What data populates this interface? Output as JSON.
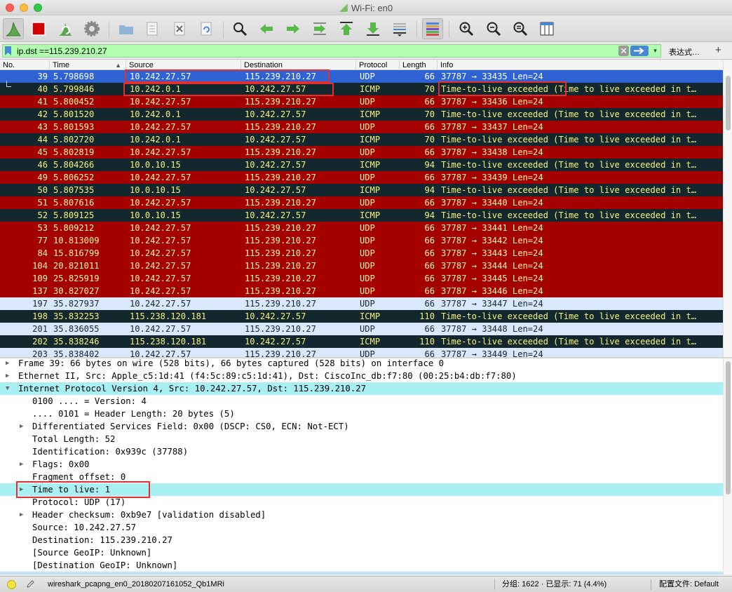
{
  "window": {
    "title": "Wi-Fi: en0"
  },
  "toolbar": {
    "buttons": [
      "shark-fin-start-icon",
      "stop-capture-icon",
      "restart-capture-icon",
      "capture-options-icon",
      "open-file-icon",
      "save-file-icon",
      "close-file-icon",
      "reload-file-icon",
      "find-packet-icon",
      "go-back-icon",
      "go-forward-icon",
      "go-to-packet-icon",
      "go-first-icon",
      "go-last-icon",
      "auto-scroll-icon",
      "colorize-icon",
      "zoom-in-icon",
      "zoom-out-icon",
      "zoom-normal-icon",
      "resize-columns-icon"
    ]
  },
  "filter": {
    "value": "ip.dst ==115.239.210.27",
    "clear_glyph": "✕",
    "dropdown_glyph": "▾",
    "expression_label": "表达式…",
    "add_glyph": "+"
  },
  "columns": [
    "No.",
    "Time",
    "Source",
    "Destination",
    "Protocol",
    "Length",
    "Info"
  ],
  "sort_indicator": "▲",
  "packets": [
    {
      "no": "39",
      "time": "5.798698",
      "src": "10.242.27.57",
      "dst": "115.239.210.27",
      "proto": "UDP",
      "len": "66",
      "info": "37787 → 33435  Len=24",
      "style": "sel"
    },
    {
      "no": "40",
      "time": "5.799846",
      "src": "10.242.0.1",
      "dst": "10.242.27.57",
      "proto": "ICMP",
      "len": "70",
      "info": "Time-to-live exceeded (Time to live exceeded in t…",
      "style": "dark"
    },
    {
      "no": "41",
      "time": "5.800452",
      "src": "10.242.27.57",
      "dst": "115.239.210.27",
      "proto": "UDP",
      "len": "66",
      "info": "37787 → 33436  Len=24",
      "style": "red"
    },
    {
      "no": "42",
      "time": "5.801520",
      "src": "10.242.0.1",
      "dst": "10.242.27.57",
      "proto": "ICMP",
      "len": "70",
      "info": "Time-to-live exceeded (Time to live exceeded in t…",
      "style": "dark"
    },
    {
      "no": "43",
      "time": "5.801593",
      "src": "10.242.27.57",
      "dst": "115.239.210.27",
      "proto": "UDP",
      "len": "66",
      "info": "37787 → 33437  Len=24",
      "style": "red"
    },
    {
      "no": "44",
      "time": "5.802720",
      "src": "10.242.0.1",
      "dst": "10.242.27.57",
      "proto": "ICMP",
      "len": "70",
      "info": "Time-to-live exceeded (Time to live exceeded in t…",
      "style": "dark"
    },
    {
      "no": "45",
      "time": "5.802819",
      "src": "10.242.27.57",
      "dst": "115.239.210.27",
      "proto": "UDP",
      "len": "66",
      "info": "37787 → 33438  Len=24",
      "style": "red"
    },
    {
      "no": "46",
      "time": "5.804266",
      "src": "10.0.10.15",
      "dst": "10.242.27.57",
      "proto": "ICMP",
      "len": "94",
      "info": "Time-to-live exceeded (Time to live exceeded in t…",
      "style": "dark"
    },
    {
      "no": "49",
      "time": "5.806252",
      "src": "10.242.27.57",
      "dst": "115.239.210.27",
      "proto": "UDP",
      "len": "66",
      "info": "37787 → 33439  Len=24",
      "style": "red"
    },
    {
      "no": "50",
      "time": "5.807535",
      "src": "10.0.10.15",
      "dst": "10.242.27.57",
      "proto": "ICMP",
      "len": "94",
      "info": "Time-to-live exceeded (Time to live exceeded in t…",
      "style": "dark"
    },
    {
      "no": "51",
      "time": "5.807616",
      "src": "10.242.27.57",
      "dst": "115.239.210.27",
      "proto": "UDP",
      "len": "66",
      "info": "37787 → 33440  Len=24",
      "style": "red"
    },
    {
      "no": "52",
      "time": "5.809125",
      "src": "10.0.10.15",
      "dst": "10.242.27.57",
      "proto": "ICMP",
      "len": "94",
      "info": "Time-to-live exceeded (Time to live exceeded in t…",
      "style": "dark"
    },
    {
      "no": "53",
      "time": "5.809212",
      "src": "10.242.27.57",
      "dst": "115.239.210.27",
      "proto": "UDP",
      "len": "66",
      "info": "37787 → 33441  Len=24",
      "style": "red"
    },
    {
      "no": "77",
      "time": "10.813009",
      "src": "10.242.27.57",
      "dst": "115.239.210.27",
      "proto": "UDP",
      "len": "66",
      "info": "37787 → 33442  Len=24",
      "style": "red"
    },
    {
      "no": "84",
      "time": "15.816799",
      "src": "10.242.27.57",
      "dst": "115.239.210.27",
      "proto": "UDP",
      "len": "66",
      "info": "37787 → 33443  Len=24",
      "style": "red"
    },
    {
      "no": "104",
      "time": "20.821011",
      "src": "10.242.27.57",
      "dst": "115.239.210.27",
      "proto": "UDP",
      "len": "66",
      "info": "37787 → 33444  Len=24",
      "style": "red"
    },
    {
      "no": "109",
      "time": "25.825919",
      "src": "10.242.27.57",
      "dst": "115.239.210.27",
      "proto": "UDP",
      "len": "66",
      "info": "37787 → 33445  Len=24",
      "style": "red"
    },
    {
      "no": "137",
      "time": "30.827027",
      "src": "10.242.27.57",
      "dst": "115.239.210.27",
      "proto": "UDP",
      "len": "66",
      "info": "37787 → 33446  Len=24",
      "style": "red"
    },
    {
      "no": "197",
      "time": "35.827937",
      "src": "10.242.27.57",
      "dst": "115.239.210.27",
      "proto": "UDP",
      "len": "66",
      "info": "37787 → 33447  Len=24",
      "style": "light"
    },
    {
      "no": "198",
      "time": "35.832253",
      "src": "115.238.120.181",
      "dst": "10.242.27.57",
      "proto": "ICMP",
      "len": "110",
      "info": "Time-to-live exceeded (Time to live exceeded in t…",
      "style": "dark"
    },
    {
      "no": "201",
      "time": "35.836055",
      "src": "10.242.27.57",
      "dst": "115.239.210.27",
      "proto": "UDP",
      "len": "66",
      "info": "37787 → 33448  Len=24",
      "style": "light"
    },
    {
      "no": "202",
      "time": "35.838246",
      "src": "115.238.120.181",
      "dst": "10.242.27.57",
      "proto": "ICMP",
      "len": "110",
      "info": "Time-to-live exceeded (Time to live exceeded in t…",
      "style": "dark"
    },
    {
      "no": "203",
      "time": "35.838402",
      "src": "10.242.27.57",
      "dst": "115.239.210.27",
      "proto": "UDP",
      "len": "66",
      "info": "37787 → 33449  Len=24",
      "style": "light"
    }
  ],
  "details": [
    {
      "text": "Frame 39: 66 bytes on wire (528 bits), 66 bytes captured (528 bits) on interface 0",
      "arrow": "▶",
      "indent": 0
    },
    {
      "text": "Ethernet II, Src: Apple_c5:1d:41 (f4:5c:89:c5:1d:41), Dst: CiscoInc_db:f7:80 (00:25:b4:db:f7:80)",
      "arrow": "▶",
      "indent": 0
    },
    {
      "text": "Internet Protocol Version 4, Src: 10.242.27.57, Dst: 115.239.210.27",
      "arrow": "▼",
      "indent": 0,
      "hl": true
    },
    {
      "text": "0100 .... = Version: 4",
      "arrow": "",
      "indent": 1
    },
    {
      "text": ".... 0101 = Header Length: 20 bytes (5)",
      "arrow": "",
      "indent": 1
    },
    {
      "text": "Differentiated Services Field: 0x00 (DSCP: CS0, ECN: Not-ECT)",
      "arrow": "▶",
      "indent": 1
    },
    {
      "text": "Total Length: 52",
      "arrow": "",
      "indent": 1
    },
    {
      "text": "Identification: 0x939c (37788)",
      "arrow": "",
      "indent": 1
    },
    {
      "text": "Flags: 0x00",
      "arrow": "▶",
      "indent": 1
    },
    {
      "text": "Fragment offset: 0",
      "arrow": "",
      "indent": 1
    },
    {
      "text": "Time to live: 1",
      "arrow": "▶",
      "indent": 1,
      "hl": true
    },
    {
      "text": "Protocol: UDP (17)",
      "arrow": "",
      "indent": 1
    },
    {
      "text": "Header checksum: 0xb9e7 [validation disabled]",
      "arrow": "▶",
      "indent": 1
    },
    {
      "text": "Source: 10.242.27.57",
      "arrow": "",
      "indent": 1
    },
    {
      "text": "Destination: 115.239.210.27",
      "arrow": "",
      "indent": 1
    },
    {
      "text": "[Source GeoIP: Unknown]",
      "arrow": "",
      "indent": 1
    },
    {
      "text": "[Destination GeoIP: Unknown]",
      "arrow": "",
      "indent": 1
    }
  ],
  "status": {
    "file": "wireshark_pcapng_en0_20180207161052_Qb1MRi",
    "stats": "分组: 1622 · 已显示: 71 (4.4%)",
    "profile": "配置文件: Default"
  },
  "scrollbars": {
    "packet_list_position": 0.06,
    "details_position": 0.02
  },
  "colors": {
    "selected": "#2f63d3",
    "udp_red": "#a40000",
    "icmp_dark": "#12272e",
    "light": "#dae8fc",
    "filter_ok": "#afffaf",
    "detail_highlight": "#a9f0f4",
    "annotation_red": "#e23030"
  }
}
